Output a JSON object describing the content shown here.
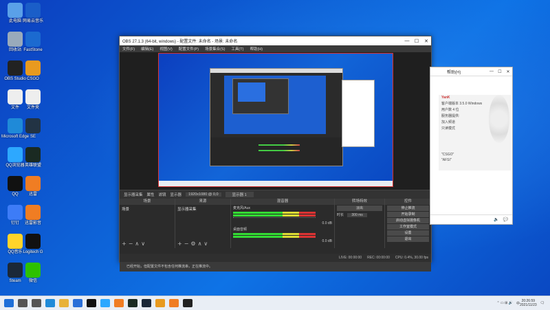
{
  "desktop": {
    "icons_left": [
      {
        "label": "此电脑",
        "icon": "computer-icon",
        "color": "#5aa0e8"
      },
      {
        "label": "回收站",
        "icon": "recycle-bin-icon",
        "color": "#9ab"
      },
      {
        "label": "OBS Studio",
        "icon": "obs-icon",
        "color": "#222"
      },
      {
        "label": "文件",
        "icon": "file-icon",
        "color": "#eee"
      },
      {
        "label": "Microsoft Edge",
        "icon": "edge-icon",
        "color": "#1f8ad8"
      },
      {
        "label": "QQ浏览器",
        "icon": "qq-browser-icon",
        "color": "#2da8ff"
      },
      {
        "label": "QQ",
        "icon": "qq-icon",
        "color": "#111"
      },
      {
        "label": "钉钉",
        "icon": "dingtalk-icon",
        "color": "#3d7cf7"
      },
      {
        "label": "QQ音乐",
        "icon": "qq-music-icon",
        "color": "#ffd42a"
      },
      {
        "label": "Steam",
        "icon": "steam-icon",
        "color": "#1b2838"
      }
    ],
    "icons_right": [
      {
        "label": "网易云音乐",
        "icon": "clock-app-icon",
        "color": "#1a5ec8"
      },
      {
        "label": "FastStone",
        "icon": "faststone-icon",
        "color": "#1b6ad0"
      },
      {
        "label": "CSGO",
        "icon": "csgo-icon",
        "color": "#e89a1f"
      },
      {
        "label": "文件夹",
        "icon": "file2-icon",
        "color": "#eee"
      },
      {
        "label": "SE",
        "icon": "se-icon",
        "color": "#234"
      },
      {
        "label": "英雄联盟",
        "icon": "lol-icon",
        "color": "#1a2a22"
      },
      {
        "label": "迅雷",
        "icon": "orange-app-icon",
        "color": "#f07d23"
      },
      {
        "label": "迅雷影音",
        "icon": "orange-app2-icon",
        "color": "#f07d23"
      },
      {
        "label": "Logitech G",
        "icon": "logitech-icon",
        "color": "#111"
      },
      {
        "label": "微信",
        "icon": "wechat-icon",
        "color": "#2dc100"
      }
    ]
  },
  "obs": {
    "title": "OBS 27.1.3 (64-bit, windows) - 配置文件: 未命名 - 场景: 未命名",
    "window_controls": [
      "—",
      "☐",
      "✕"
    ],
    "menu": [
      "文件(F)",
      "编辑(E)",
      "视图(V)",
      "配置文件(P)",
      "场景集合(S)",
      "工具(T)",
      "帮助(H)"
    ],
    "source_toolbar": [
      "显示器采集",
      "属性",
      "滤镜",
      "显示器",
      "1920x1080 @ 0,0",
      "显示器 1"
    ],
    "docks": {
      "scenes": {
        "title": "场景",
        "items": [
          "场景"
        ]
      },
      "sources": {
        "title": "来源",
        "items": [
          "显示器采集"
        ]
      },
      "mixer": {
        "title": "混音器",
        "channels": [
          {
            "name": "麦克风/Aux",
            "db": "0.0 dB"
          },
          {
            "name": "桌面音频",
            "db": "0.0 dB"
          }
        ]
      },
      "transitions": {
        "title": "转场特效",
        "type": "淡出",
        "duration_label": "时长",
        "duration": "300 ms"
      },
      "controls": {
        "title": "控件",
        "buttons": [
          "停止推流",
          "开始录制",
          "启动虚拟摄像机",
          "工作室模式",
          "设置",
          "退出"
        ]
      }
    },
    "status": {
      "live": "LIVE: 00:00:00",
      "rec": "REC: 00:00:00",
      "cpu": "CPU: 0.4%, 30.00 fps"
    },
    "notice": "已经开始，但配置文件不包含任何推流串，正在推流中。"
  },
  "chat_window": {
    "menu": "帮助(H)",
    "title": "YanK",
    "rows": [
      "客户端版本  3.5.0 Windows",
      "用户数    4 位",
      "服务器提供:",
      "加入频道",
      "只读模式",
      "\"CSGO\"",
      "\"AFSI\""
    ],
    "bottom_icons": [
      "speaker-icon",
      "chat-icon"
    ]
  },
  "taskbar": {
    "apps": [
      {
        "icon": "start-icon",
        "color": "#1f6fd8"
      },
      {
        "icon": "search-icon",
        "color": "#555"
      },
      {
        "icon": "task-view-icon",
        "color": "#555"
      },
      {
        "icon": "edge-icon",
        "color": "#1f8ad8"
      },
      {
        "icon": "folder-icon",
        "color": "#e8b23a"
      },
      {
        "icon": "store-icon",
        "color": "#2a6fd8"
      },
      {
        "icon": "logitech-icon",
        "color": "#111"
      },
      {
        "icon": "qq-browser-icon",
        "color": "#2da8ff"
      },
      {
        "icon": "orange-app-icon",
        "color": "#f07d23"
      },
      {
        "icon": "lol-icon",
        "color": "#1a2a22"
      },
      {
        "icon": "steam-icon",
        "color": "#1b2838"
      },
      {
        "icon": "csgo-icon",
        "color": "#e89a1f"
      },
      {
        "icon": "orange-app2-icon",
        "color": "#f07d23"
      },
      {
        "icon": "obs-icon",
        "color": "#222"
      }
    ],
    "tray": {
      "lang": "中",
      "time": "20:26:59",
      "date": "2021/11/23"
    }
  }
}
